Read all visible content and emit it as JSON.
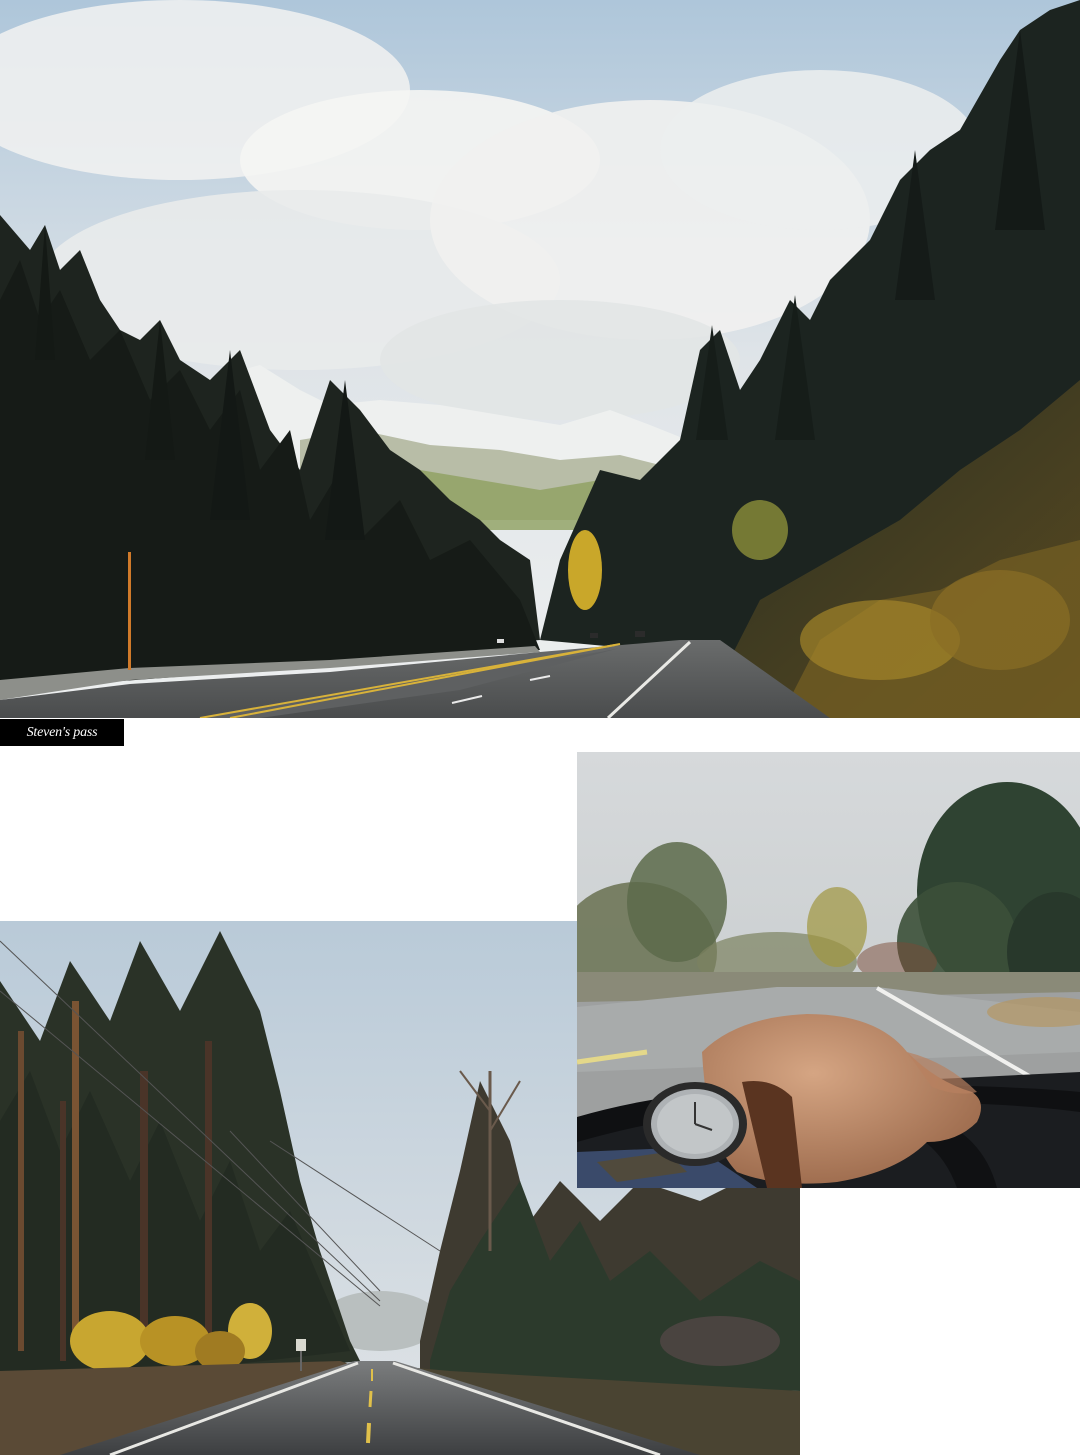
{
  "caption": "Steven's pass",
  "colors": {
    "sky": "#c9d5df",
    "forest": "#1f2620",
    "road": "#55585a",
    "autumn": "#b89a2e"
  }
}
